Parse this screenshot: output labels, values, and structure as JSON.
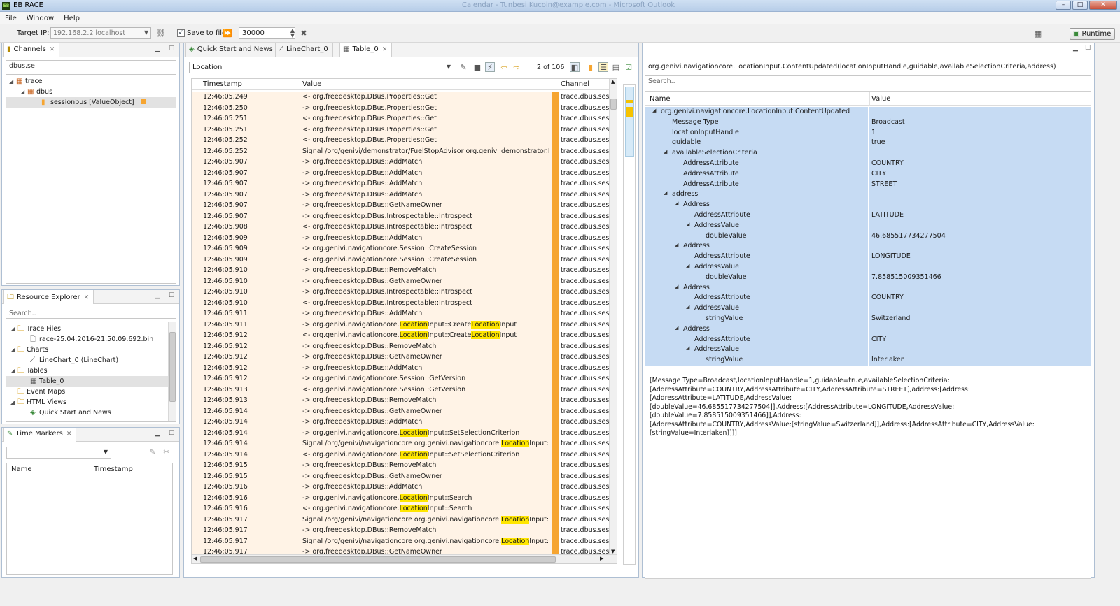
{
  "window": {
    "app_title": "EB RACE",
    "title": "Calendar - Tunbesi Kucoin@example.com - Microsoft Outlook"
  },
  "menu": [
    "File",
    "Window",
    "Help"
  ],
  "toolbar": {
    "target_ip_label": "Target IP:",
    "target_ip_value": "192.168.2.2 localhost",
    "save_to_file_label": "Save to file",
    "save_to_file_checked": true,
    "buffer_value": "30000",
    "runtime_label": "Runtime"
  },
  "channels_panel": {
    "tab_label": "Channels",
    "filter_value": "dbus.se",
    "tree": [
      {
        "label": "trace",
        "level": 0
      },
      {
        "label": "dbus",
        "level": 1
      },
      {
        "label": "sessionbus [ValueObject]",
        "level": 2
      }
    ]
  },
  "resource_explorer": {
    "tab_label": "Resource Explorer",
    "search_placeholder": "Search..",
    "tree": [
      {
        "label": "Trace Files",
        "level": 0,
        "icon": "folder-icon"
      },
      {
        "label": "race-25.04.2016-21.50.09.692.bin",
        "level": 1,
        "icon": "file-icon"
      },
      {
        "label": "Charts",
        "level": 0,
        "icon": "folder-icon"
      },
      {
        "label": "LineChart_0 (LineChart)",
        "level": 1,
        "icon": "chart-icon"
      },
      {
        "label": "Tables",
        "level": 0,
        "icon": "folder-icon"
      },
      {
        "label": "Table_0",
        "level": 1,
        "icon": "table-icon"
      },
      {
        "label": "Event Maps",
        "level": 0,
        "icon": "folder-icon"
      },
      {
        "label": "HTML Views",
        "level": 0,
        "icon": "folder-icon"
      },
      {
        "label": "Quick Start and News",
        "level": 1,
        "icon": "html-icon"
      }
    ]
  },
  "time_markers": {
    "tab_label": "Time Markers",
    "columns": [
      "Name",
      "Timestamp"
    ]
  },
  "editor_tabs": [
    "Quick Start and News",
    "LineChart_0",
    "Table_0"
  ],
  "table_view": {
    "filter_value": "Location",
    "highlight_term": "Location",
    "match_counter": "2 of 106",
    "columns": [
      "Timestamp",
      "Value",
      "Channel"
    ],
    "rows": [
      {
        "ts": "12:46:05.249",
        "value": "<- org.freedesktop.DBus.Properties::Get",
        "channel": "trace.dbus.sessi"
      },
      {
        "ts": "12:46:05.250",
        "value": "-> org.freedesktop.DBus.Properties::Get",
        "channel": "trace.dbus.sessi"
      },
      {
        "ts": "12:46:05.251",
        "value": "<- org.freedesktop.DBus.Properties::Get",
        "channel": "trace.dbus.sessi"
      },
      {
        "ts": "12:46:05.251",
        "value": "<- org.freedesktop.DBus.Properties::Get",
        "channel": "trace.dbus.sessi"
      },
      {
        "ts": "12:46:05.252",
        "value": "<- org.freedesktop.DBus.Properties::Get",
        "channel": "trace.dbus.sessi"
      },
      {
        "ts": "12:46:05.252",
        "value": "Signal /org/genivi/demonstrator/FuelStopAdvisor org.genivi.demonstrator.FuelS",
        "channel": "trace.dbus.sessi"
      },
      {
        "ts": "12:46:05.907",
        "value": "-> org.freedesktop.DBus::AddMatch",
        "channel": "trace.dbus.sessi"
      },
      {
        "ts": "12:46:05.907",
        "value": "-> org.freedesktop.DBus::AddMatch",
        "channel": "trace.dbus.sessi"
      },
      {
        "ts": "12:46:05.907",
        "value": "-> org.freedesktop.DBus::AddMatch",
        "channel": "trace.dbus.sessi"
      },
      {
        "ts": "12:46:05.907",
        "value": "-> org.freedesktop.DBus::AddMatch",
        "channel": "trace.dbus.sessi"
      },
      {
        "ts": "12:46:05.907",
        "value": "-> org.freedesktop.DBus::GetNameOwner",
        "channel": "trace.dbus.sessi"
      },
      {
        "ts": "12:46:05.907",
        "value": "-> org.freedesktop.DBus.Introspectable::Introspect",
        "channel": "trace.dbus.sessi"
      },
      {
        "ts": "12:46:05.908",
        "value": "<- org.freedesktop.DBus.Introspectable::Introspect",
        "channel": "trace.dbus.sessi"
      },
      {
        "ts": "12:46:05.909",
        "value": "-> org.freedesktop.DBus::AddMatch",
        "channel": "trace.dbus.sessi"
      },
      {
        "ts": "12:46:05.909",
        "value": "-> org.genivi.navigationcore.Session::CreateSession",
        "channel": "trace.dbus.sessi"
      },
      {
        "ts": "12:46:05.909",
        "value": "<- org.genivi.navigationcore.Session::CreateSession",
        "channel": "trace.dbus.sessi"
      },
      {
        "ts": "12:46:05.910",
        "value": "-> org.freedesktop.DBus::RemoveMatch",
        "channel": "trace.dbus.sessi"
      },
      {
        "ts": "12:46:05.910",
        "value": "-> org.freedesktop.DBus::GetNameOwner",
        "channel": "trace.dbus.sessi"
      },
      {
        "ts": "12:46:05.910",
        "value": "-> org.freedesktop.DBus.Introspectable::Introspect",
        "channel": "trace.dbus.sessi"
      },
      {
        "ts": "12:46:05.910",
        "value": "<- org.freedesktop.DBus.Introspectable::Introspect",
        "channel": "trace.dbus.sessi"
      },
      {
        "ts": "12:46:05.911",
        "value": "-> org.freedesktop.DBus::AddMatch",
        "channel": "trace.dbus.sessi"
      },
      {
        "ts": "12:46:05.911",
        "value": "-> org.genivi.navigationcore.LocationInput::CreateLocationInput",
        "channel": "trace.dbus.sessi"
      },
      {
        "ts": "12:46:05.912",
        "value": "<- org.genivi.navigationcore.LocationInput::CreateLocationInput",
        "channel": "trace.dbus.sessi"
      },
      {
        "ts": "12:46:05.912",
        "value": "-> org.freedesktop.DBus::RemoveMatch",
        "channel": "trace.dbus.sessi"
      },
      {
        "ts": "12:46:05.912",
        "value": "-> org.freedesktop.DBus::GetNameOwner",
        "channel": "trace.dbus.sessi"
      },
      {
        "ts": "12:46:05.912",
        "value": "-> org.freedesktop.DBus::AddMatch",
        "channel": "trace.dbus.sessi"
      },
      {
        "ts": "12:46:05.912",
        "value": "-> org.genivi.navigationcore.Session::GetVersion",
        "channel": "trace.dbus.sessi"
      },
      {
        "ts": "12:46:05.913",
        "value": "<- org.genivi.navigationcore.Session::GetVersion",
        "channel": "trace.dbus.sessi"
      },
      {
        "ts": "12:46:05.913",
        "value": "-> org.freedesktop.DBus::RemoveMatch",
        "channel": "trace.dbus.sessi"
      },
      {
        "ts": "12:46:05.914",
        "value": "-> org.freedesktop.DBus::GetNameOwner",
        "channel": "trace.dbus.sessi"
      },
      {
        "ts": "12:46:05.914",
        "value": "-> org.freedesktop.DBus::AddMatch",
        "channel": "trace.dbus.sessi"
      },
      {
        "ts": "12:46:05.914",
        "value": "-> org.genivi.navigationcore.LocationInput::SetSelectionCriterion",
        "channel": "trace.dbus.sessi"
      },
      {
        "ts": "12:46:05.914",
        "value": "Signal /org/genivi/navigationcore org.genivi.navigationcore.LocationInput::Curre",
        "channel": "trace.dbus.sessi"
      },
      {
        "ts": "12:46:05.914",
        "value": "<- org.genivi.navigationcore.LocationInput::SetSelectionCriterion",
        "channel": "trace.dbus.sessi"
      },
      {
        "ts": "12:46:05.915",
        "value": "-> org.freedesktop.DBus::RemoveMatch",
        "channel": "trace.dbus.sessi"
      },
      {
        "ts": "12:46:05.915",
        "value": "-> org.freedesktop.DBus::GetNameOwner",
        "channel": "trace.dbus.sessi"
      },
      {
        "ts": "12:46:05.916",
        "value": "-> org.freedesktop.DBus::AddMatch",
        "channel": "trace.dbus.sessi"
      },
      {
        "ts": "12:46:05.916",
        "value": "-> org.genivi.navigationcore.LocationInput::Search",
        "channel": "trace.dbus.sessi"
      },
      {
        "ts": "12:46:05.916",
        "value": "<- org.genivi.navigationcore.LocationInput::Search",
        "channel": "trace.dbus.sessi"
      },
      {
        "ts": "12:46:05.917",
        "value": "Signal /org/genivi/navigationcore org.genivi.navigationcore.LocationInput::Searc",
        "channel": "trace.dbus.sessi"
      },
      {
        "ts": "12:46:05.917",
        "value": "-> org.freedesktop.DBus::RemoveMatch",
        "channel": "trace.dbus.sessi"
      },
      {
        "ts": "12:46:05.917",
        "value": "Signal /org/genivi/navigationcore org.genivi.navigationcore.LocationInput::Searc",
        "channel": "trace.dbus.sessi"
      },
      {
        "ts": "12:46:05.917",
        "value": "-> org.freedesktop.DBus::GetNameOwner",
        "channel": "trace.dbus.sessi"
      }
    ]
  },
  "detail_view": {
    "message_title": "org.genivi.navigationcore.LocationInput.ContentUpdated(locationInputHandle,guidable,availableSelectionCriteria,address)",
    "search_placeholder": "Search..",
    "columns": [
      "Name",
      "Value"
    ],
    "rows": [
      {
        "name": "org.genivi.navigationcore.LocationInput.ContentUpdated",
        "value": "",
        "level": 0,
        "expander": "◢"
      },
      {
        "name": "Message Type",
        "value": "Broadcast",
        "level": 1,
        "expander": ""
      },
      {
        "name": "locationInputHandle",
        "value": "1",
        "level": 1,
        "expander": ""
      },
      {
        "name": "guidable",
        "value": "true",
        "level": 1,
        "expander": ""
      },
      {
        "name": "availableSelectionCriteria",
        "value": "",
        "level": 1,
        "expander": "◢"
      },
      {
        "name": "AddressAttribute",
        "value": "COUNTRY",
        "level": 2,
        "expander": ""
      },
      {
        "name": "AddressAttribute",
        "value": "CITY",
        "level": 2,
        "expander": ""
      },
      {
        "name": "AddressAttribute",
        "value": "STREET",
        "level": 2,
        "expander": ""
      },
      {
        "name": "address",
        "value": "",
        "level": 1,
        "expander": "◢"
      },
      {
        "name": "Address",
        "value": "",
        "level": 2,
        "expander": "◢"
      },
      {
        "name": "AddressAttribute",
        "value": "LATITUDE",
        "level": 3,
        "expander": ""
      },
      {
        "name": "AddressValue",
        "value": "",
        "level": 3,
        "expander": "◢"
      },
      {
        "name": "doubleValue",
        "value": "46.685517734277504",
        "level": 4,
        "expander": ""
      },
      {
        "name": "Address",
        "value": "",
        "level": 2,
        "expander": "◢"
      },
      {
        "name": "AddressAttribute",
        "value": "LONGITUDE",
        "level": 3,
        "expander": ""
      },
      {
        "name": "AddressValue",
        "value": "",
        "level": 3,
        "expander": "◢"
      },
      {
        "name": "doubleValue",
        "value": "7.858515009351466",
        "level": 4,
        "expander": ""
      },
      {
        "name": "Address",
        "value": "",
        "level": 2,
        "expander": "◢"
      },
      {
        "name": "AddressAttribute",
        "value": "COUNTRY",
        "level": 3,
        "expander": ""
      },
      {
        "name": "AddressValue",
        "value": "",
        "level": 3,
        "expander": "◢"
      },
      {
        "name": "stringValue",
        "value": "Switzerland",
        "level": 4,
        "expander": ""
      },
      {
        "name": "Address",
        "value": "",
        "level": 2,
        "expander": "◢"
      },
      {
        "name": "AddressAttribute",
        "value": "CITY",
        "level": 3,
        "expander": ""
      },
      {
        "name": "AddressValue",
        "value": "",
        "level": 3,
        "expander": "◢"
      },
      {
        "name": "stringValue",
        "value": "Interlaken",
        "level": 4,
        "expander": ""
      }
    ],
    "summary_lines": [
      "[Message Type=Broadcast,locationInputHandle=1,guidable=true,availableSelectionCriteria:",
      "[AddressAttribute=COUNTRY,AddressAttribute=CITY,AddressAttribute=STREET],address:[Address:[AddressAttribute=LATITUDE,AddressValue:",
      "[doubleValue=46.685517734277504]],Address:[AddressAttribute=LONGITUDE,AddressValue:[doubleValue=7.858515009351466]],Address:",
      "[AddressAttribute=COUNTRY,AddressValue:[stringValue=Switzerland]],Address:[AddressAttribute=CITY,AddressValue:[stringValue=Interlaken]]]]"
    ]
  },
  "colors": {
    "row_background": "#fff3e6",
    "channel_marker": "#f6a531",
    "highlight": "#ffe600",
    "selection_blue": "#c6dbf3"
  }
}
